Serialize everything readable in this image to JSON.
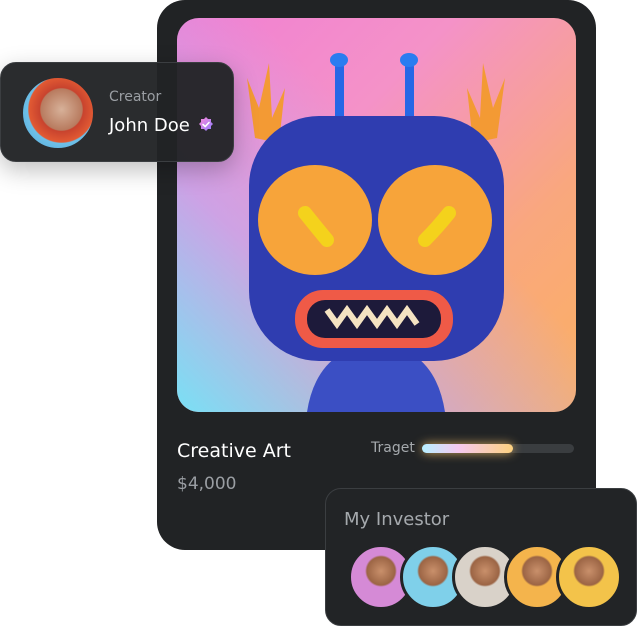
{
  "creator": {
    "label": "Creator",
    "name": "John Doe",
    "verified_icon": "verified-badge-icon"
  },
  "nft": {
    "title": "Creative Art",
    "price": "$4,000",
    "target_label": "Traget",
    "target_progress": 0.6
  },
  "investors": {
    "label": "My Investor",
    "avatars": [
      {
        "bg": "#d58ad6"
      },
      {
        "bg": "#7fd0ea"
      },
      {
        "bg": "#d9d2c9"
      },
      {
        "bg": "#f4b44c"
      },
      {
        "bg": "#f3c34a"
      }
    ]
  }
}
